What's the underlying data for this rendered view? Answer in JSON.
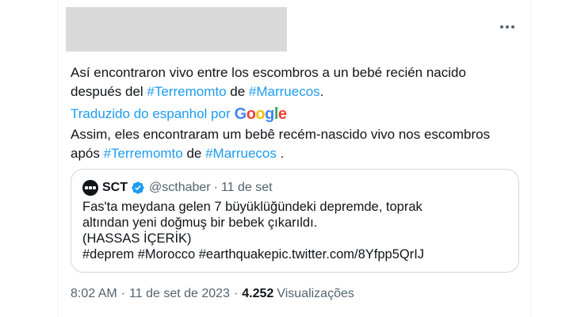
{
  "tweet": {
    "more_icon": "more-horizontal-icon",
    "text_part1": "Así encontraron vivo entre los escombros a un bebé recién nacido después del ",
    "hashtag1": "#Terremomto",
    "text_part2": " de ",
    "hashtag2": "#Marruecos",
    "text_part3": ".",
    "translated_from": "Traduzido do espanhol por",
    "google_letters": [
      "G",
      "o",
      "o",
      "g",
      "l",
      "e"
    ],
    "translation_part1": "Assim, eles encontraram um bebê recém-nascido vivo nos escombros após ",
    "translation_hashtag1": "#Terremomto",
    "translation_part2": " de ",
    "translation_hashtag2": "#Marruecos",
    "translation_part3": " ."
  },
  "quote": {
    "name": "SCT",
    "handle": "@scthaber",
    "separator": "·",
    "date": "11 de set",
    "body": "Fas'ta meydana gelen 7 büyüklüğündeki depremde, toprak\naltından yeni doğmuş bir bebek çıkarıldı.\n(HASSAS İÇERİK)\n#deprem #Morocco #earthquakepic.twitter.com/8Yfpp5QrIJ",
    "verified_color": "#1d9bf0"
  },
  "meta": {
    "time": "8:02 AM",
    "separator": "·",
    "date": "11 de set de 2023",
    "views_count": "4.252",
    "views_label": "Visualizações"
  }
}
